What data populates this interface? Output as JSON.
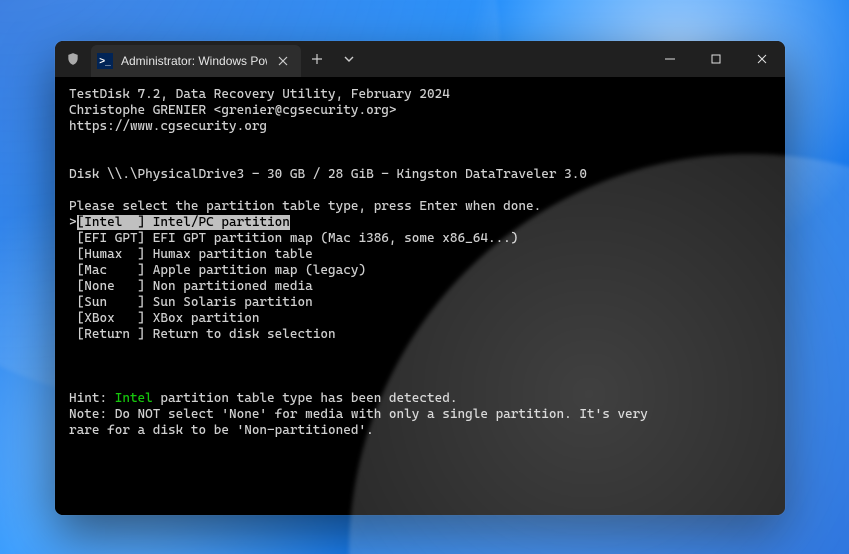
{
  "window": {
    "tab_title": "Administrator: Windows Powe",
    "shield_icon": "shield",
    "ps_icon_glyph": ">_"
  },
  "terminal": {
    "header": {
      "line1": "TestDisk 7.2, Data Recovery Utility, February 2024",
      "line2": "Christophe GRENIER <grenier@cgsecurity.org>",
      "line3": "https://www.cgsecurity.org"
    },
    "disk_line": "Disk \\\\.\\PhysicalDrive3 - 30 GB / 28 GiB - Kingston DataTraveler 3.0",
    "prompt": "Please select the partition table type, press Enter when done.",
    "options": [
      {
        "selected": true,
        "tag": "[Intel  ]",
        "desc": "Intel/PC partition"
      },
      {
        "selected": false,
        "tag": "[EFI GPT]",
        "desc": "EFI GPT partition map (Mac i386, some x86_64...)"
      },
      {
        "selected": false,
        "tag": "[Humax  ]",
        "desc": "Humax partition table"
      },
      {
        "selected": false,
        "tag": "[Mac    ]",
        "desc": "Apple partition map (legacy)"
      },
      {
        "selected": false,
        "tag": "[None   ]",
        "desc": "Non partitioned media"
      },
      {
        "selected": false,
        "tag": "[Sun    ]",
        "desc": "Sun Solaris partition"
      },
      {
        "selected": false,
        "tag": "[XBox   ]",
        "desc": "XBox partition"
      },
      {
        "selected": false,
        "tag": "[Return ]",
        "desc": "Return to disk selection"
      }
    ],
    "hint_prefix": "Hint: ",
    "hint_highlight": "Intel",
    "hint_suffix": " partition table type has been detected.",
    "note_line1": "Note: Do NOT select 'None' for media with only a single partition. It's very",
    "note_line2": "rare for a disk to be 'Non-partitioned'."
  }
}
